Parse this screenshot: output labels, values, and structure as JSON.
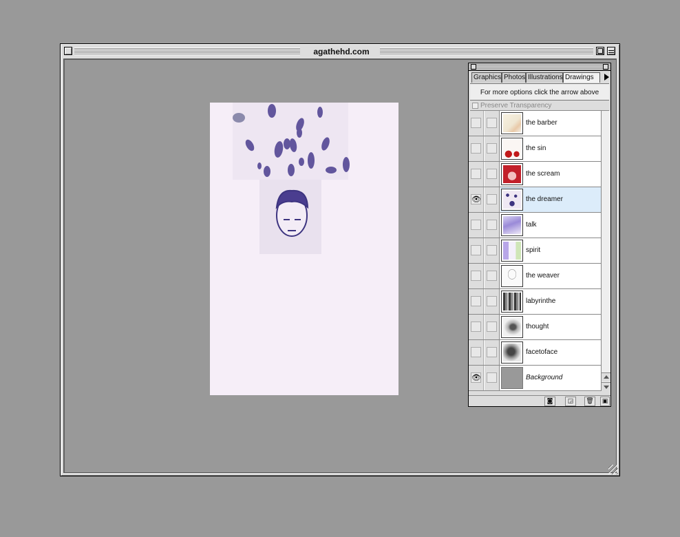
{
  "window": {
    "title": "agathehd.com"
  },
  "palette": {
    "tabs": [
      {
        "label": "Graphics"
      },
      {
        "label": "Photos"
      },
      {
        "label": "Illustrations"
      },
      {
        "label": "Drawings"
      }
    ],
    "active_tab": "Drawings",
    "hint": "For more options click the arrow above",
    "preserve_transparency": "Preserve Transparency",
    "layers": [
      {
        "name": "the barber",
        "visible": false
      },
      {
        "name": "the sin",
        "visible": false
      },
      {
        "name": "the scream",
        "visible": false
      },
      {
        "name": "the dreamer",
        "visible": true,
        "selected": true
      },
      {
        "name": "talk",
        "visible": false
      },
      {
        "name": "spirit",
        "visible": false
      },
      {
        "name": "the weaver",
        "visible": false
      },
      {
        "name": "labyrinthe",
        "visible": false
      },
      {
        "name": "thought",
        "visible": false
      },
      {
        "name": "facetoface",
        "visible": false
      },
      {
        "name": "Background",
        "visible": true
      }
    ],
    "eye_glyph": "👁",
    "footer": {
      "mask_icon": "mask-icon",
      "new_layer_icon": "new-layer-icon",
      "trash_icon": "trash-icon"
    }
  },
  "colors": {
    "desktop": "#999999",
    "selection": "#dcecfa",
    "ink": "#4a3d8f"
  }
}
